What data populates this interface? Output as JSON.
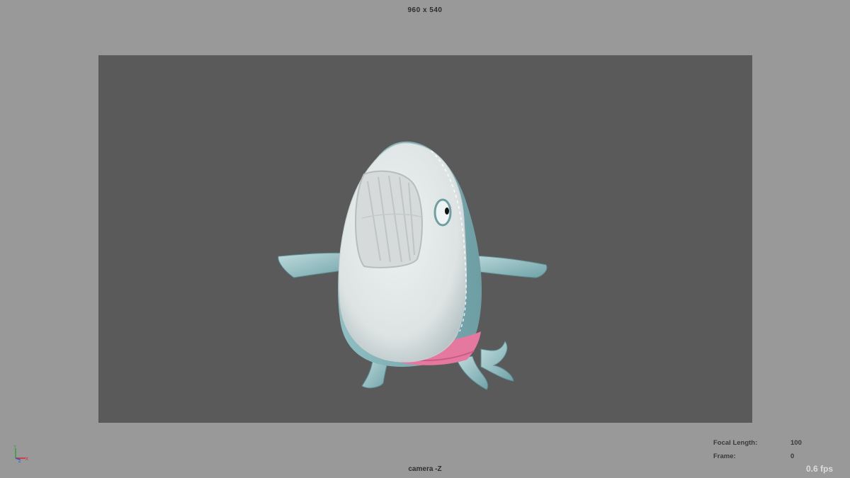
{
  "viewport": {
    "resolution_label": "960 x 540",
    "camera_label": "camera -Z",
    "fps_label": "0.6 fps"
  },
  "hud": {
    "focal_length": {
      "label": "Focal Length:",
      "value": "100"
    },
    "frame": {
      "label": "Frame:",
      "value": "0"
    }
  },
  "axis": {
    "x": "X",
    "y": "Y",
    "z": "Z"
  },
  "colors": {
    "background": "#999999",
    "render_region": "#5a5a5a",
    "shark_body": "#9cc6c9",
    "shark_belly": "#dde3e3",
    "shorts": "#e5789e",
    "axis_x": "#d62828",
    "axis_y": "#2ea32e",
    "axis_z": "#2d5bd6"
  },
  "icons": {
    "axis_gizmo": "view-axis-icon",
    "character": "shark-character"
  }
}
